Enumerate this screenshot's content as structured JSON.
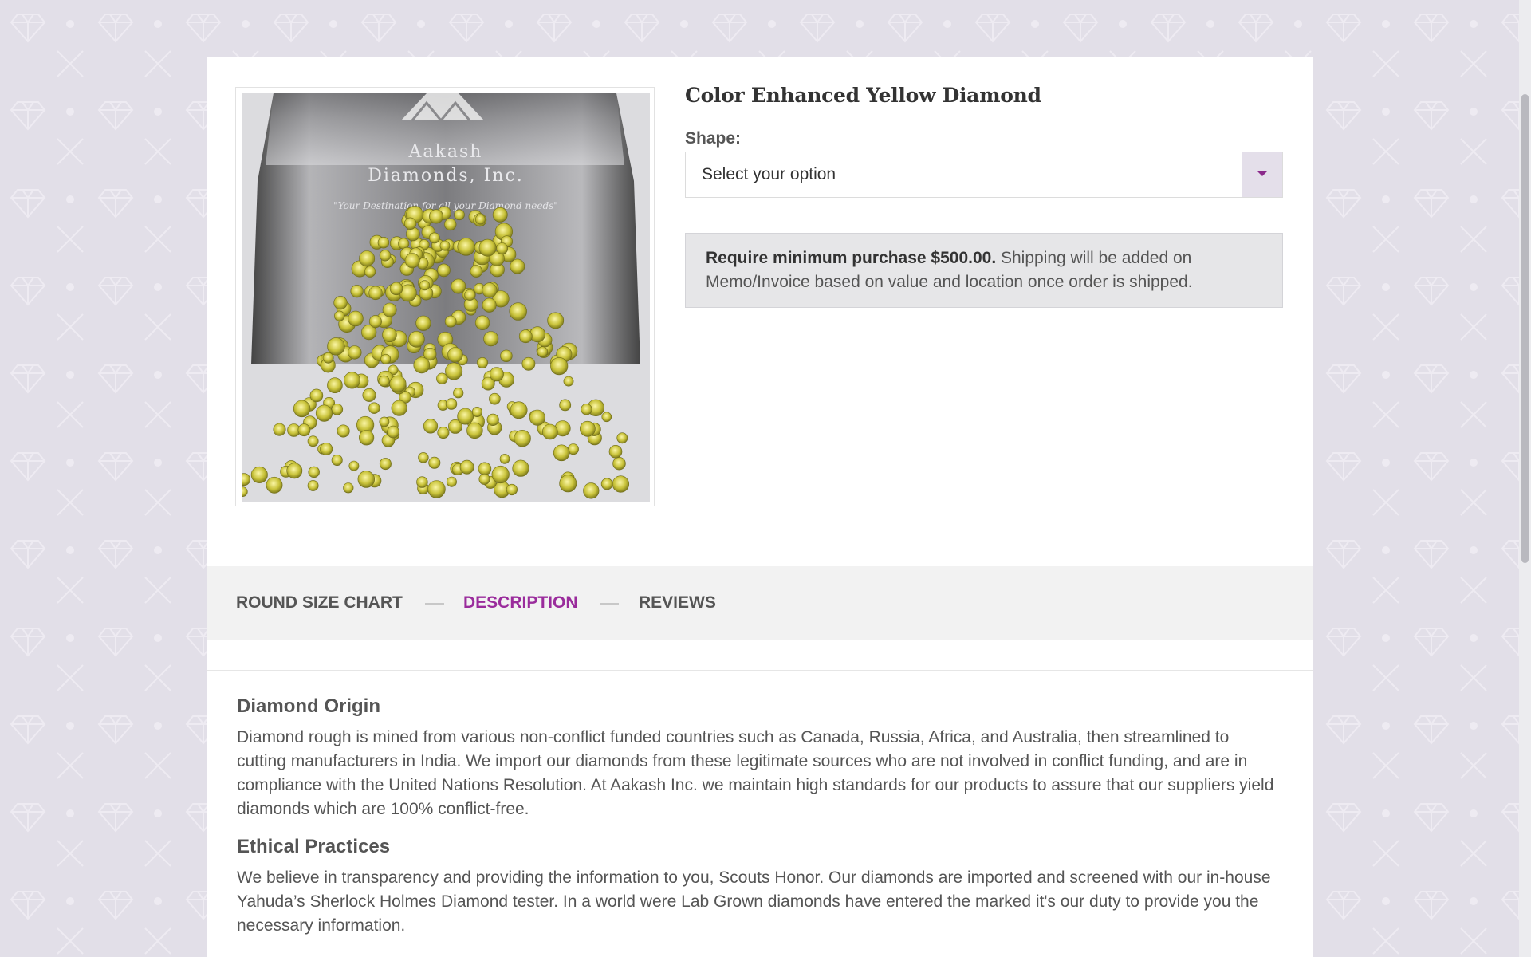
{
  "product": {
    "title": "Color Enhanced Yellow Diamond",
    "image_alt": "Yellow diamonds on Aakash Diamonds, Inc. tray",
    "tray_brand_line1": "Aakash",
    "tray_brand_line2": "Diamonds, Inc.",
    "tray_tagline": "\"Your Destination for all your Diamond needs\""
  },
  "options": {
    "shape_label": "Shape:",
    "shape_selected": "Select your option"
  },
  "notice": {
    "bold": "Require minimum purchase $500.00.",
    "text": " Shipping will be added on Memo/Invoice based on value and location once order is shipped."
  },
  "tabs": [
    {
      "label": "Round Size Chart",
      "active": false
    },
    {
      "label": "Description",
      "active": true
    },
    {
      "label": "Reviews",
      "active": false
    }
  ],
  "description": {
    "sections": [
      {
        "heading": "Diamond Origin",
        "body": "Diamond rough is mined from various non-conflict funded countries such as Canada, Russia, Africa, and Australia, then streamlined to cutting manufacturers in India. We import our diamonds from these legitimate sources who are not involved in conflict funding, and are in compliance with the United Nations Resolution. At Aakash Inc. we maintain high standards for our products to assure that our suppliers yield diamonds which are 100% conflict-free."
      },
      {
        "heading": "Ethical Practices",
        "body": "We believe in transparency and providing the information to you, Scouts Honor. Our diamonds are imported and screened with our in-house Yahuda’s Sherlock Holmes Diamond tester. In a world were Lab Grown diamonds have entered the marked it's our duty to provide you the necessary information."
      }
    ]
  },
  "colors": {
    "background": "#e2dfe8",
    "accent": "#9a2c9c",
    "card": "#ffffff",
    "notice_bg": "#e6e6e8"
  },
  "icons": {
    "select_caret": "chevron-down-icon",
    "background_pattern": "diamond-icon"
  }
}
